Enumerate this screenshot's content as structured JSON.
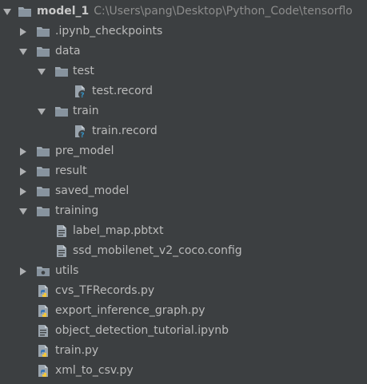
{
  "project": {
    "name": "model_1",
    "path": "C:\\Users\\pang\\Desktop\\Python_Code\\tensorflo"
  },
  "items": [
    {
      "label": ".ipynb_checkpoints",
      "icon": "folder-icon",
      "expanded": false
    },
    {
      "label": "data",
      "icon": "folder-icon",
      "expanded": true
    },
    {
      "label": "test",
      "icon": "folder-icon",
      "expanded": true
    },
    {
      "label": "test.record",
      "icon": "unknown-file-icon"
    },
    {
      "label": "train",
      "icon": "folder-icon",
      "expanded": true
    },
    {
      "label": "train.record",
      "icon": "unknown-file-icon"
    },
    {
      "label": "pre_model",
      "icon": "folder-icon",
      "expanded": false
    },
    {
      "label": "result",
      "icon": "folder-icon",
      "expanded": false
    },
    {
      "label": "saved_model",
      "icon": "folder-icon",
      "expanded": false
    },
    {
      "label": "training",
      "icon": "folder-icon",
      "expanded": true
    },
    {
      "label": "label_map.pbtxt",
      "icon": "text-file-icon"
    },
    {
      "label": "ssd_mobilenet_v2_coco.config",
      "icon": "text-file-icon"
    },
    {
      "label": "utils",
      "icon": "package-folder-icon",
      "expanded": false
    },
    {
      "label": "cvs_TFRecords.py",
      "icon": "python-file-icon"
    },
    {
      "label": "export_inference_graph.py",
      "icon": "python-file-icon"
    },
    {
      "label": "object_detection_tutorial.ipynb",
      "icon": "text-file-icon"
    },
    {
      "label": "train.py",
      "icon": "python-file-icon"
    },
    {
      "label": "xml_to_csv.py",
      "icon": "python-file-icon"
    }
  ]
}
